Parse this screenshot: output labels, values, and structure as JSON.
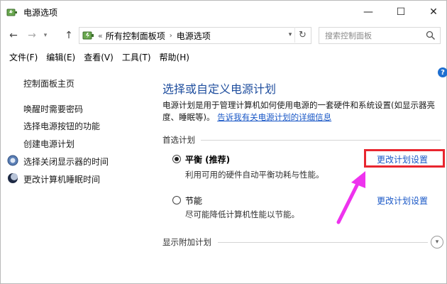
{
  "window": {
    "title": "电源选项",
    "controls": {
      "minimize": "—",
      "maximize": "☐",
      "close": "✕"
    }
  },
  "address_bar": {
    "overflow": "«",
    "segments": [
      "所有控制面板项",
      "电源选项"
    ],
    "separator": "›",
    "search_placeholder": "搜索控制面板"
  },
  "menu": [
    "文件(F)",
    "编辑(E)",
    "查看(V)",
    "工具(T)",
    "帮助(H)"
  ],
  "sidebar": {
    "items": [
      {
        "label": "控制面板主页"
      },
      {
        "label": "唤醒时需要密码"
      },
      {
        "label": "选择电源按钮的功能"
      },
      {
        "label": "创建电源计划"
      },
      {
        "label": "选择关闭显示器的时间",
        "icon": "monitor-icon"
      },
      {
        "label": "更改计算机睡眠时间",
        "icon": "moon-icon"
      }
    ]
  },
  "main": {
    "title": "选择或自定义电源计划",
    "description": "电源计划是用于管理计算机如何使用电源的一套硬件和系统设置(如显示器亮度、睡眠等)。",
    "description_link": "告诉我有关电源计划的详细信息",
    "preferred_label": "首选计划",
    "plans": [
      {
        "name": "平衡 (推荐)",
        "description": "利用可用的硬件自动平衡功耗与性能。",
        "link": "更改计划设置",
        "selected": true
      },
      {
        "name": "节能",
        "description": "尽可能降低计算机性能以节能。",
        "link": "更改计划设置",
        "selected": false
      }
    ],
    "more_plans_label": "显示附加计划"
  },
  "annotation": {
    "highlight_color": "#e8262f",
    "arrow_color": "#ee33ee"
  }
}
